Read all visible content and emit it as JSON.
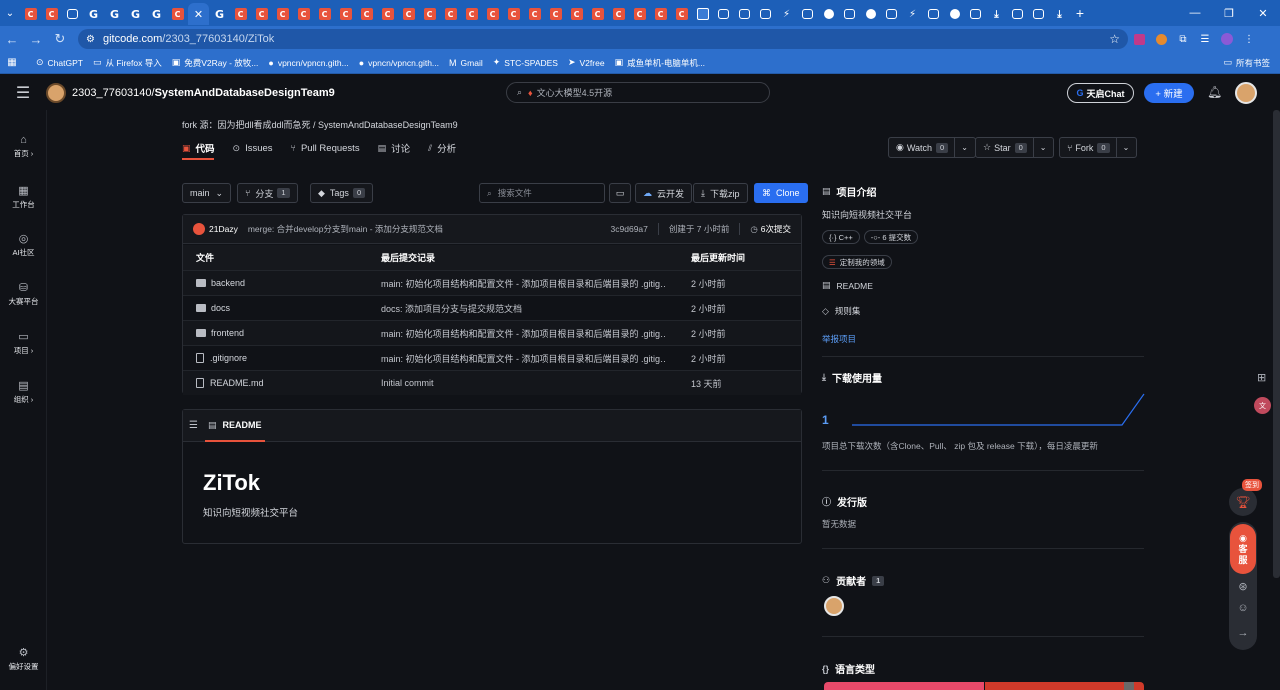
{
  "browser": {
    "tab_count": 40,
    "tab_kinds": [
      "c",
      "c",
      "t",
      "g",
      "g",
      "g",
      "g",
      "c",
      "x",
      "g",
      "c",
      "c",
      "c",
      "c",
      "c",
      "c",
      "c",
      "c",
      "c",
      "c",
      "c",
      "c",
      "c",
      "c",
      "c",
      "c",
      "c",
      "c",
      "c",
      "c",
      "c",
      "c",
      "b",
      "t",
      "t",
      "t",
      "l",
      "t",
      "w",
      "t",
      "w",
      "t",
      "l",
      "t",
      "w",
      "t",
      "d",
      "t",
      "t",
      "d"
    ],
    "url_host": "gitcode.com",
    "url_path": "/2303_77603140/ZiTok",
    "bookmarks": [
      {
        "label": "ChatGPT",
        "icon": "⊙"
      },
      {
        "label": "从 Firefox 导入",
        "icon": "▭"
      },
      {
        "label": "免费V2Ray - 放牧...",
        "icon": "▣"
      },
      {
        "label": "vpncn/vpncn.gith...",
        "icon": "●"
      },
      {
        "label": "vpncn/vpncn.gith...",
        "icon": "●"
      },
      {
        "label": "Gmail",
        "icon": "M"
      },
      {
        "label": "STC-SPADES",
        "icon": "✦"
      },
      {
        "label": "V2free",
        "icon": "➤"
      },
      {
        "label": "咸鱼单机-电脑单机...",
        "icon": "▣"
      }
    ],
    "bookmarks_right": "所有书签"
  },
  "header": {
    "owner": "2303_77603140/",
    "repo_group": "SystemAndDatabaseDesignTeam9",
    "ai_search": "文心大模型4.5开源",
    "chat_label": "天启Chat",
    "new_label": "+ 新建"
  },
  "sidebar": {
    "items": [
      {
        "label": "首页 ›",
        "icon": "⌂"
      },
      {
        "label": "工作台",
        "icon": "▦"
      },
      {
        "label": "AI社区",
        "icon": "◎"
      },
      {
        "label": "大赛平台",
        "icon": "⛁"
      },
      {
        "label": "项目 ›",
        "icon": "▭"
      },
      {
        "label": "组织 ›",
        "icon": "▤"
      }
    ],
    "settings": "偏好设置"
  },
  "repo": {
    "fork_line": "fork 源：因为把dll看成ddl而急死 / SystemAndDatabaseDesignTeam9",
    "tabs": [
      {
        "label": "代码",
        "icon": "▣"
      },
      {
        "label": "Issues",
        "icon": "⊙"
      },
      {
        "label": "Pull Requests",
        "icon": "⑂"
      },
      {
        "label": "讨论",
        "icon": "▤"
      },
      {
        "label": "分析",
        "icon": "⫽"
      }
    ],
    "watch": {
      "label": "Watch",
      "count": "0"
    },
    "star": {
      "label": "Star",
      "count": "0"
    },
    "fork": {
      "label": "Fork",
      "count": "0"
    },
    "branch": "main",
    "branches": {
      "label": "分支",
      "count": "1"
    },
    "tags": {
      "label": "Tags",
      "count": "0"
    },
    "search_placeholder": "搜索文件",
    "cloud_dev": "云开发",
    "download_zip": "下载zip",
    "clone": "Clone"
  },
  "commit": {
    "user": "21Dazy",
    "message": "merge: 合并develop分支到main - 添加分支规范文档",
    "hash": "3c9d69a7",
    "created": "创建于 7 小时前",
    "count": "6次提交"
  },
  "files": {
    "headers": [
      "文件",
      "最后提交记录",
      "最后更新时间"
    ],
    "rows": [
      {
        "name": "backend",
        "type": "folder",
        "msg": "main: 初始化项目结构和配置文件 - 添加项目根目录和后端目录的 .gitig…",
        "time": "2 小时前"
      },
      {
        "name": "docs",
        "type": "folder",
        "msg": "docs: 添加项目分支与提交规范文档",
        "time": "2 小时前"
      },
      {
        "name": "frontend",
        "type": "folder",
        "msg": "main: 初始化项目结构和配置文件 - 添加项目根目录和后端目录的 .gitig…",
        "time": "2 小时前"
      },
      {
        "name": ".gitignore",
        "type": "file",
        "msg": "main: 初始化项目结构和配置文件 - 添加项目根目录和后端目录的 .gitig…",
        "time": "2 小时前"
      },
      {
        "name": "README.md",
        "type": "file",
        "msg": "Initial commit",
        "time": "13 天前"
      }
    ]
  },
  "readme": {
    "tab": "README",
    "title": "ZiTok",
    "desc": "知识向短视频社交平台"
  },
  "about": {
    "title": "项目介绍",
    "desc": "知识向短视频社交平台",
    "lang_pill": "{·} C++",
    "commits_pill": "-○- 6 提交数",
    "custom_pill": "定制我的领域",
    "readme": "README",
    "rules": "规则集",
    "report": "举报项目"
  },
  "downloads": {
    "title": "下载使用量",
    "count": "1",
    "note": "项目总下载次数（含Clone、Pull、 zip 包及 release 下载），每日凌晨更新"
  },
  "releases": {
    "title": "发行版",
    "empty": "暂无数据"
  },
  "contributors": {
    "title": "贡献者",
    "count": "1"
  },
  "languages": {
    "title": "语言类型"
  },
  "float": {
    "sign": "签到",
    "kefu_line1": "客",
    "kefu_line2": "服"
  },
  "colors": {
    "accent": "#e8533c",
    "primary": "#2a6ef0",
    "browser": "#2d6fcc"
  }
}
